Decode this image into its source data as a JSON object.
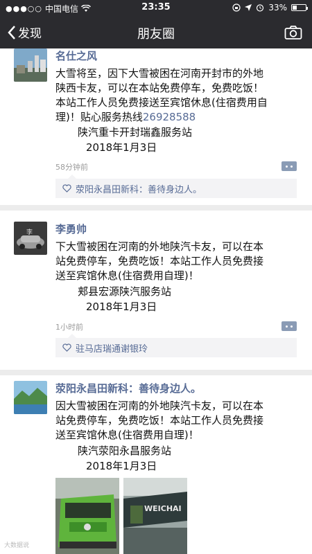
{
  "status_bar": {
    "signal": "●●●○○",
    "carrier": "中国电信",
    "time": "23:35",
    "battery": "33%",
    "battery_level": 0.33
  },
  "nav": {
    "back_label": "发现",
    "title": "朋友圈"
  },
  "posts": [
    {
      "name": "名仕之风",
      "lines": [
        "大雪将至，因下大雪被困在河南开封市的外地",
        "陕西卡友，可以在本站免费停车，免费吃饭！",
        "本站工作人员免费接送至宾馆休息(住宿费用自",
        "理)！贴心服务热线"
      ],
      "phone": "26928588",
      "sign": "陕汽重卡开封瑞鑫服务站",
      "date": "2018年1月3日",
      "time": "58分钟前",
      "likes": "荥阳永昌田新科：善待身边人。"
    },
    {
      "name": "李勇帅",
      "lines": [
        "下大雪被困在河南的外地陕汽卡友，可以在本",
        "站免费停车，免费吃饭！本站工作人员免费接",
        "送至宾馆休息(住宿费用自理)！"
      ],
      "sign": "郏县宏源陕汽服务站",
      "date": "2018年1月3日",
      "time": "1小时前",
      "likes": "驻马店瑞通谢银玲"
    },
    {
      "name": "荥阳永昌田新科：善待身边人。",
      "lines": [
        "因大雪被困在河南的外地陕汽卡友，可以在本",
        "站免费停车，免费吃饭！本站工作人员免费接",
        "送至宾馆休息(住宿费用自理)！"
      ],
      "sign": "陕汽荥阳永昌服务站",
      "date": "2018年1月3日",
      "photo2_text": "WEICHAI"
    }
  ],
  "watermark": "大数据说"
}
